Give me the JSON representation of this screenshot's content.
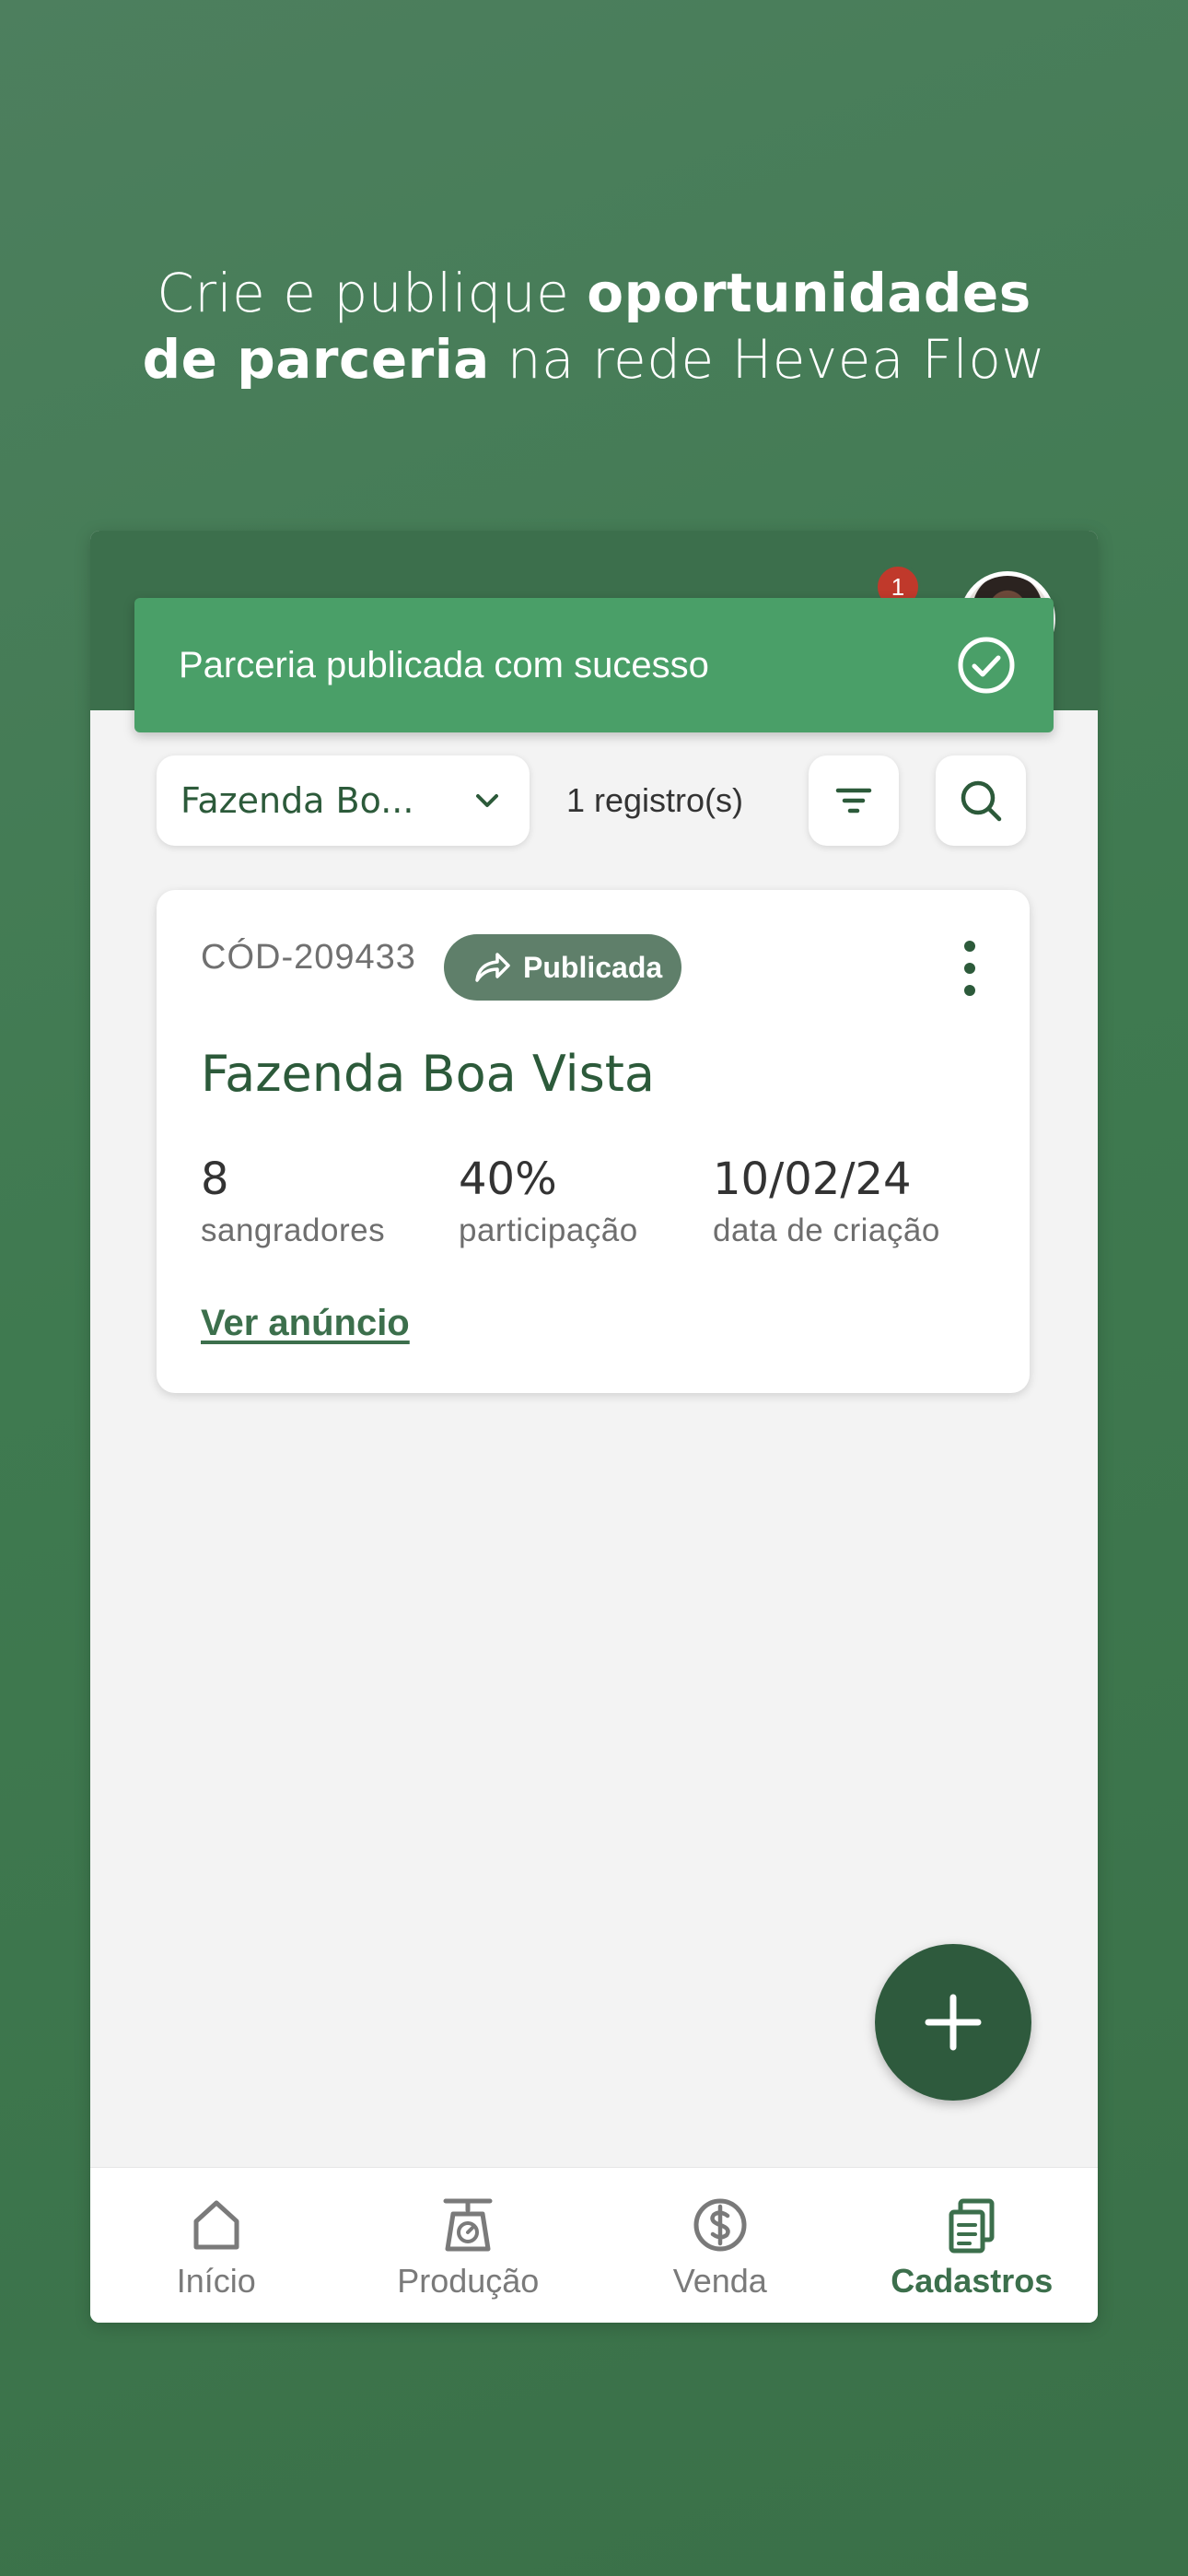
{
  "headline": {
    "part1": "Crie e publique ",
    "bold1": "oportunidades",
    "bold2": "de parceria",
    "part2": " na rede Hevea Flow"
  },
  "header": {
    "notification_count": "1"
  },
  "toast": {
    "message": "Parceria publicada com sucesso"
  },
  "filters": {
    "farm_select_value": "Fazenda Bo...",
    "record_count": "1 registro(s)"
  },
  "card": {
    "code": "CÓD-209433",
    "status": "Publicada",
    "title": "Fazenda Boa Vista",
    "stats": [
      {
        "value": "8",
        "label": "sangradores"
      },
      {
        "value": "40%",
        "label": "participação"
      },
      {
        "value": "10/02/24",
        "label": "data de criação"
      }
    ],
    "link": "Ver anúncio"
  },
  "bottom_nav": [
    {
      "label": "Início",
      "icon": "home-icon",
      "active": false
    },
    {
      "label": "Produção",
      "icon": "scale-icon",
      "active": false
    },
    {
      "label": "Venda",
      "icon": "dollar-icon",
      "active": false
    },
    {
      "label": "Cadastros",
      "icon": "documents-icon",
      "active": true
    }
  ],
  "colors": {
    "primary": "#3c6f4c",
    "toast": "#4a9f68",
    "fab": "#2e5a3d",
    "badge": "#c0392b"
  }
}
